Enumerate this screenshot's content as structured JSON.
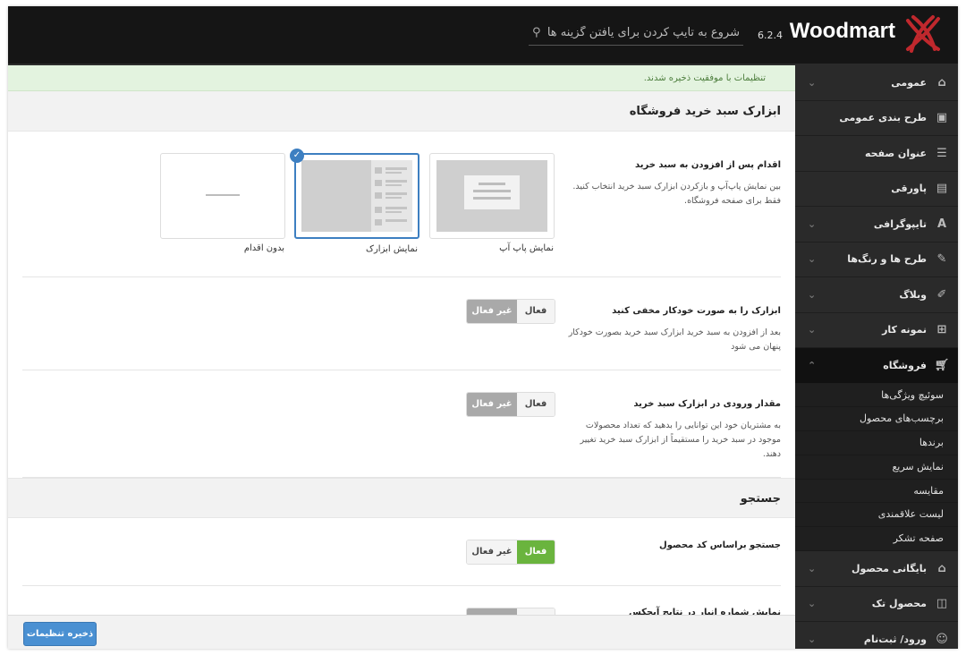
{
  "header": {
    "brand": "Woodmart",
    "version": "6.2.4",
    "search_placeholder": "شروع به تایپ کردن برای یافتن گزینه ها"
  },
  "notice": "تنظیمات با موفقیت ذخیره شدند.",
  "sidebar": {
    "items": [
      {
        "label": "عمومی",
        "icon": "home-icon"
      },
      {
        "label": "طرح بندی عمومی",
        "icon": "layout-icon"
      },
      {
        "label": "عنوان صفحه",
        "icon": "page-title-icon"
      },
      {
        "label": "پاورقی",
        "icon": "footer-icon"
      },
      {
        "label": "تایپوگرافی",
        "icon": "typography-icon"
      },
      {
        "label": "طرح ها و رنگ‌ها",
        "icon": "brush-icon"
      },
      {
        "label": "وبلاگ",
        "icon": "edit-icon"
      },
      {
        "label": "نمونه کار",
        "icon": "grid-icon"
      },
      {
        "label": "فروشگاه",
        "icon": "cart-icon"
      }
    ],
    "subitems": [
      "سوئیچ ویژگی‌ها",
      "برچسب‌های محصول",
      "برندها",
      "نمایش سریع",
      "مقایسه",
      "لیست علاقمندی",
      "صفحه تشکر"
    ],
    "items_after": [
      {
        "label": "بایگانی محصول",
        "icon": "store-icon"
      },
      {
        "label": "محصول تک",
        "icon": "bag-icon"
      },
      {
        "label": "ورود/ ثبت‌نام",
        "icon": "user-icon"
      }
    ]
  },
  "sections": {
    "cart_widget_title": "ابزارک سبد خرید فروشگاه",
    "search_title": "جستجو"
  },
  "options": {
    "after_add": {
      "title": "اقدام پس از افزودن به سبد خرید",
      "desc": "بین نمایش پاپ‌آپ و بازکردن ابزارک سبد خرید انتخاب کنید. فقط برای صفحه فروشگاه.",
      "choices": [
        "نمایش پاپ آپ",
        "نمایش ابزارک",
        "بدون اقدام"
      ],
      "selected": "نمایش ابزارک"
    },
    "auto_hide": {
      "title": "ابزارک را به صورت خودکار مخفی کنید",
      "desc": "بعد از افزودن به سبد خرید ابزارک سبد خرید بصورت خودکار پنهان می شود",
      "on_label": "فعال",
      "off_label": "غیر فعال",
      "value": "غیر فعال"
    },
    "qty_input": {
      "title": "مقدار ورودی در ابزارک سبد خرید",
      "desc": "به مشتریان خود این توانایی را بدهید که تعداد محصولات موجود در سبد خرید را مستقیماً از ابزارک سبد خرید تغییر دهند.",
      "on_label": "فعال",
      "off_label": "غیر فعال",
      "value": "غیر فعال"
    },
    "sku_search": {
      "title": "جستجو براساس کد محصول",
      "on_label": "فعال",
      "off_label": "غیر فعال",
      "value": "فعال"
    },
    "partial_title": "نمایش شماره انبار در نتایج آیجکس"
  },
  "footer": {
    "save_label": "ذخیره تنظیمات"
  },
  "colors": {
    "accent": "#3d7fc1",
    "success": "#6ab43e",
    "header_bg": "#151515",
    "sidebar_bg": "#2a2a2a"
  }
}
